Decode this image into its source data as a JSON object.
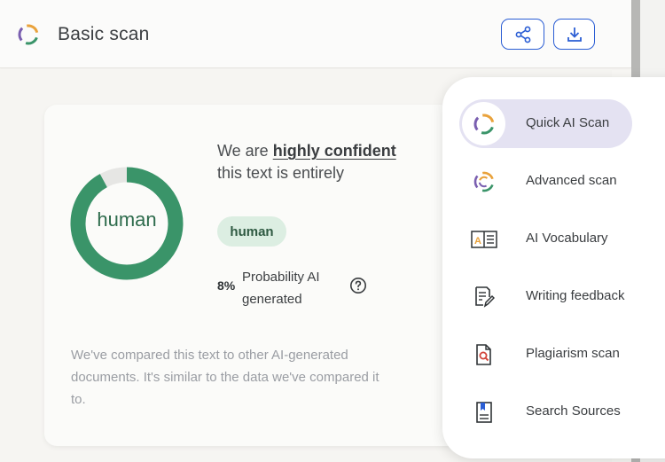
{
  "header": {
    "title": "Basic scan",
    "share_icon": "share-icon",
    "download_icon": "download-icon"
  },
  "result": {
    "donut_label": "human",
    "human_fraction": 0.92,
    "statement_prefix": "We are ",
    "statement_emphasis": "highly confident",
    "statement_suffix": " this text is entirely",
    "badge": "human",
    "probability_value": "8%",
    "probability_label": "Probability AI generated",
    "note": "We've compared this text to other AI-generated documents. It's similar to the data we've compared it to."
  },
  "menu": {
    "items": [
      {
        "label": "Quick AI Scan",
        "icon": "quick-scan-icon",
        "active": true
      },
      {
        "label": "Advanced scan",
        "icon": "advanced-scan-icon",
        "active": false
      },
      {
        "label": "AI Vocabulary",
        "icon": "vocabulary-icon",
        "active": false
      },
      {
        "label": "Writing feedback",
        "icon": "writing-feedback-icon",
        "active": false
      },
      {
        "label": "Plagiarism scan",
        "icon": "plagiarism-icon",
        "active": false
      },
      {
        "label": "Search Sources",
        "icon": "search-sources-icon",
        "active": false
      }
    ]
  },
  "colors": {
    "accent_blue": "#2a5dd4",
    "human_green": "#3a9469",
    "donut_remainder": "#e6e6e4",
    "badge_bg": "#dceee2",
    "menu_active_bg": "#e4e2f2"
  }
}
